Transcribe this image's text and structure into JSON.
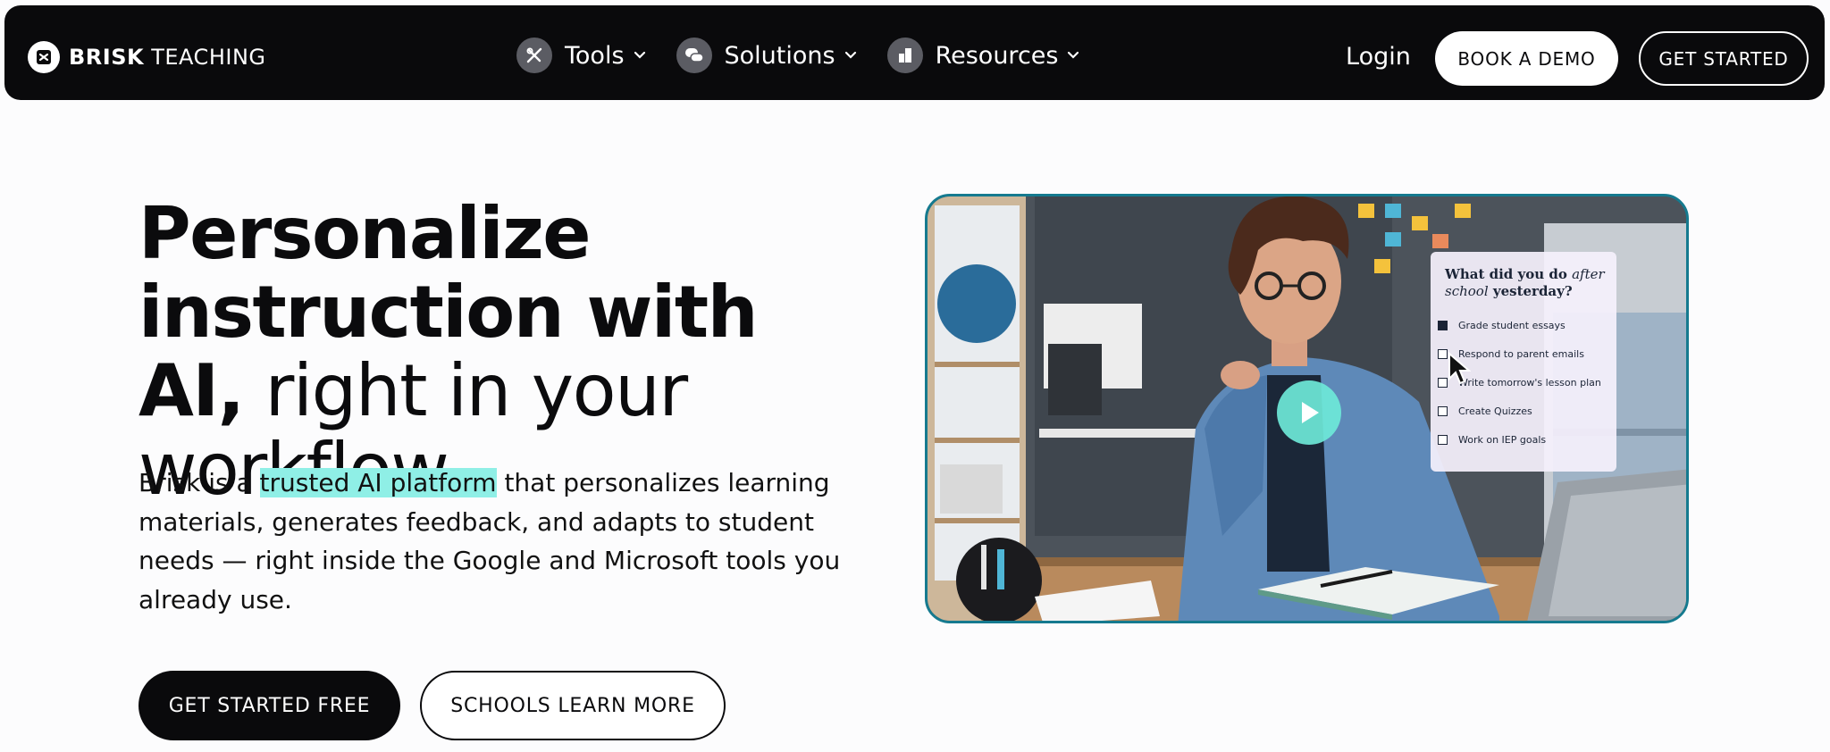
{
  "nav": {
    "brand_bold": "BRISK",
    "brand_light": "TEACHING",
    "brand_logo_icon": "brisk-logo-icon",
    "items": [
      {
        "label": "Tools",
        "icon": "tools-icon"
      },
      {
        "label": "Solutions",
        "icon": "chat-bubbles-icon"
      },
      {
        "label": "Resources",
        "icon": "book-icon"
      }
    ],
    "login": "Login",
    "book_demo": "BOOK A DEMO",
    "get_started": "GET STARTED"
  },
  "hero": {
    "headline_bold": "Personalize instruction with AI,",
    "headline_regular": "right in your workflow",
    "desc_before": "Brisk is a",
    "desc_highlight": "trusted AI platform",
    "desc_after": "that personalizes learning materials, generates feedback, and adapts to student needs — right inside the Google and Microsoft tools you already use.",
    "cta_primary": "GET STARTED FREE",
    "cta_secondary": "SCHOOLS LEARN MORE"
  },
  "video": {
    "card_title_line1_a": "What did you do",
    "card_title_line1_b": "after",
    "card_title_line2_a": "school",
    "card_title_line2_b": "yesterday?",
    "items": [
      {
        "label": "Grade student essays",
        "checked": true
      },
      {
        "label": "Respond to parent emails",
        "checked": false
      },
      {
        "label": "Write tomorrow's lesson plan",
        "checked": false
      },
      {
        "label": "Create Quizzes",
        "checked": false
      },
      {
        "label": "Work on IEP goals",
        "checked": false
      }
    ],
    "play_icon": "play-icon",
    "cursor_icon": "mouse-cursor-icon"
  },
  "colors": {
    "nav_bg": "#0a0a0c",
    "highlight": "#8fefe6",
    "video_border": "#157a8f",
    "play_button": "#6ee8d8"
  }
}
